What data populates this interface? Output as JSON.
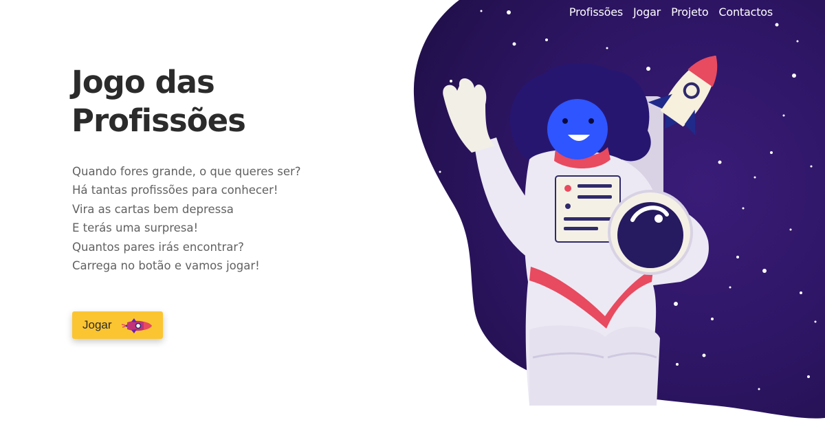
{
  "nav": {
    "items": [
      "Profissões",
      "Jogar",
      "Projeto",
      "Contactos"
    ]
  },
  "hero": {
    "title": "Jogo das Profissões",
    "poem": [
      "Quando fores grande, o que queres ser?",
      "Há tantas profissões para conhecer!",
      "Vira as cartas bem depressa",
      "E terás uma surpresa!",
      "Quantos pares irás encontrar?",
      "Carrega no botão e vamos jogar!"
    ],
    "button_label": "Jogar"
  },
  "colors": {
    "space": "#2c1560",
    "button": "#fbc531",
    "title": "#2b2b2b",
    "text": "#616161",
    "nav_text": "#ffffff"
  },
  "icons": [
    "space-blob-background",
    "astronaut-illustration",
    "rocket-illustration",
    "rocket-icon"
  ]
}
